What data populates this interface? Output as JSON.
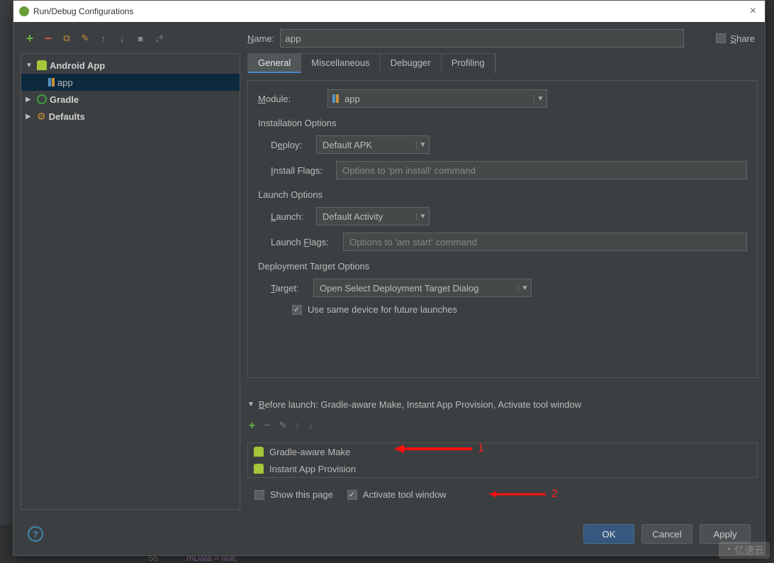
{
  "window": {
    "title": "Run/Debug Configurations"
  },
  "name_field": {
    "label": "Name:",
    "value": "app"
  },
  "share_label": "Share",
  "tree": {
    "android_app": "Android App",
    "app": "app",
    "gradle": "Gradle",
    "defaults": "Defaults"
  },
  "tabs": {
    "general": "General",
    "misc": "Miscellaneous",
    "debugger": "Debugger",
    "profiling": "Profiling"
  },
  "form": {
    "module_label": "Module:",
    "module_value": "app",
    "install_section": "Installation Options",
    "deploy_label": "Deploy:",
    "deploy_value": "Default APK",
    "install_flags_label": "Install Flags:",
    "install_flags_ph": "Options to 'pm install' command",
    "launch_section": "Launch Options",
    "launch_label": "Launch:",
    "launch_value": "Default Activity",
    "launch_flags_label": "Launch Flags:",
    "launch_flags_ph": "Options to 'am start' command",
    "deploy_target_section": "Deployment Target Options",
    "target_label": "Target:",
    "target_value": "Open Select Deployment Target Dialog",
    "use_same_device": "Use same device for future launches"
  },
  "before_launch": {
    "header": "Before launch: Gradle-aware Make, Instant App Provision, Activate tool window",
    "items": [
      "Gradle-aware Make",
      "Instant App Provision"
    ],
    "show_this_page": "Show this page",
    "activate_tool": "Activate tool window"
  },
  "buttons": {
    "ok": "OK",
    "cancel": "Cancel",
    "apply": "Apply"
  },
  "annotations": {
    "a1": "1",
    "a2": "2"
  },
  "watermark": "亿速云",
  "bg_code": "mData = null;"
}
